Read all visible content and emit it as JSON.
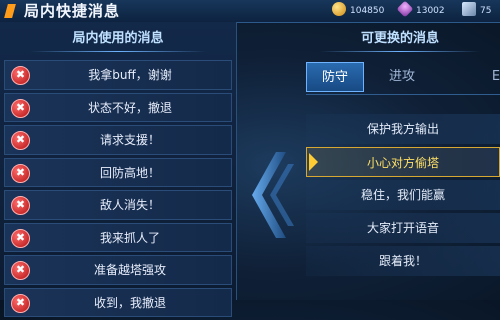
{
  "header": {
    "title": "局内快捷消息",
    "coins": "104850",
    "gems": "13002",
    "tickets": "75"
  },
  "left_panel": {
    "title": "局内使用的消息",
    "messages": [
      {
        "text": "我拿buff，谢谢",
        "delete_icon": "✖"
      },
      {
        "text": "状态不好，撤退",
        "delete_icon": "✖"
      },
      {
        "text": "请求支援！",
        "delete_icon": "✖"
      },
      {
        "text": "回防高地！",
        "delete_icon": "✖"
      },
      {
        "text": "敌人消失！",
        "delete_icon": "✖"
      },
      {
        "text": "我来抓人了",
        "delete_icon": "✖"
      },
      {
        "text": "准备越塔强攻",
        "delete_icon": "✖"
      },
      {
        "text": "收到，我撤退",
        "delete_icon": "✖"
      }
    ]
  },
  "right_panel": {
    "title": "可更换的消息",
    "tabs": [
      "防守",
      "进攻",
      "E"
    ],
    "active_tab": "防守",
    "options": [
      "保护我方输出",
      "小心对方偷塔",
      "稳住，我们能赢",
      "大家打开语音",
      "跟着我！"
    ],
    "selected_option": "小心对方偷塔"
  },
  "colors": {
    "accent_gold": "#ffcc33",
    "delete_red": "#d42020",
    "tab_active": "#2a6bb0"
  }
}
